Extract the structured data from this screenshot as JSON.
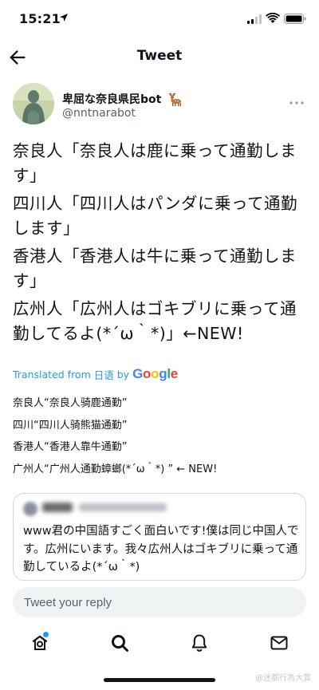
{
  "status_bar": {
    "time": "15:21"
  },
  "nav": {
    "title": "Tweet"
  },
  "author": {
    "name": "卑屈な奈良県民bot",
    "handle": "@nntnarabot"
  },
  "tweet": {
    "lines": [
      "奈良人「奈良人は鹿に乗って通勤します」",
      "四川人「四川人はパンダに乗って通勤します」",
      "香港人「香港人は牛に乗って通勤します」",
      "広州人「広州人はゴキブリに乗って通勤してるよ(*´ω｀*)」←NEW!"
    ]
  },
  "translation": {
    "label": "Translated from",
    "language": "日语",
    "by": "by",
    "provider": "Google",
    "lines": [
      "奈良人“奈良人骑鹿通勤”",
      "四川“四川人骑熊猫通勤”",
      "香港人“香港人靠牛通勤”",
      "广州人“广州人通勤蟑螂(*´ω｀*) ” ← NEW!"
    ]
  },
  "quote": {
    "text": "www君の中国語すごく面白いです!僕は同じ中国人です。広州にいます。我々広州人はゴキブリに乗って通勤しているよ(*´ω｀*)"
  },
  "reply": {
    "placeholder": "Tweet your reply"
  },
  "tabs": [
    "home-icon",
    "search-icon",
    "notifications-icon",
    "messages-icon"
  ],
  "watermark": "@迷都行為大賞",
  "colors": {
    "accent": "#1d9bf0",
    "text": "#0f1419",
    "muted": "#536471",
    "border": "#cfd9de"
  }
}
